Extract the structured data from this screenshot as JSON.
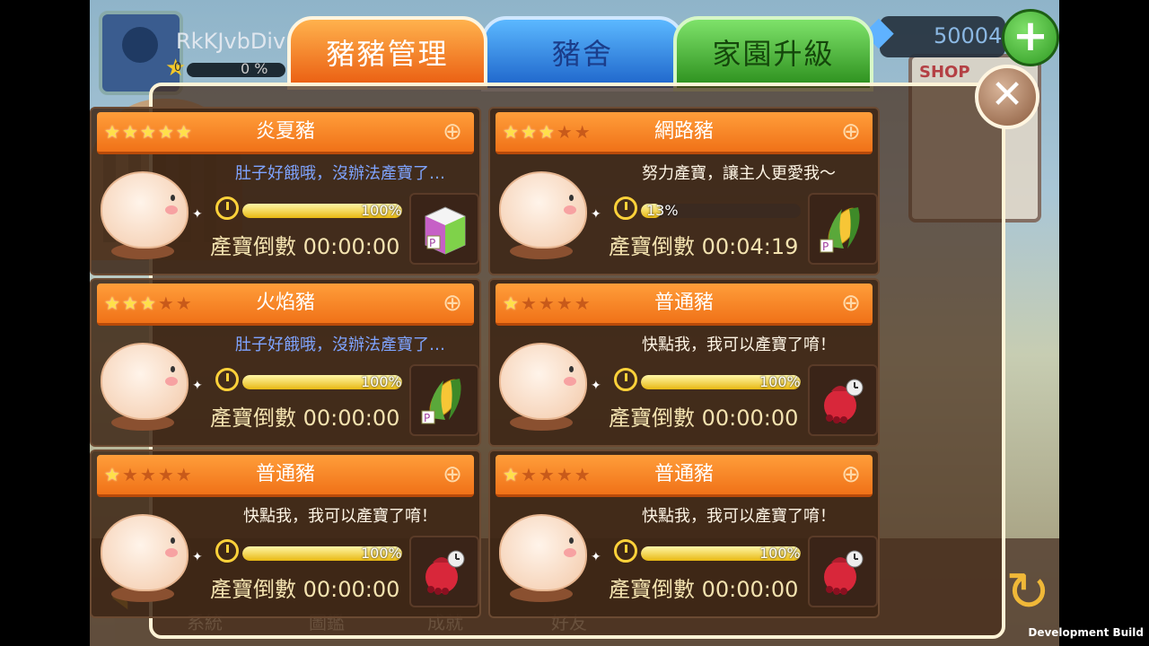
{
  "hud": {
    "username": "RkKJvbDiv",
    "level": "0",
    "xp_percent": "0 %",
    "gems": "50004",
    "add_label": "+"
  },
  "tabs": [
    {
      "label": "豬豬管理",
      "active": true
    },
    {
      "label": "豬舍",
      "active": false
    },
    {
      "label": "家園升級",
      "active": false
    }
  ],
  "close_label": "✕",
  "countdown_label": "產寶倒數",
  "pigs": [
    {
      "name": "炎夏豬",
      "stars": 5,
      "message": "肚子好餓哦，沒辦法產寶了…",
      "message_style": "blue",
      "progress": 100,
      "progress_text": "100%",
      "countdown": "00:00:00",
      "item": "milk-box-icon"
    },
    {
      "name": "網路豬",
      "stars": 3,
      "message": "努力產寶，讓主人更愛我～",
      "message_style": "white",
      "progress": 13,
      "progress_text": "13%",
      "countdown": "00:04:19",
      "item": "corn-icon"
    },
    {
      "name": "火焰豬",
      "stars": 3,
      "message": "肚子好餓哦，沒辦法產寶了…",
      "message_style": "blue",
      "progress": 100,
      "progress_text": "100%",
      "countdown": "00:00:00",
      "item": "corn-icon"
    },
    {
      "name": "普通豬",
      "stars": 1,
      "message": "快點我，我可以產寶了唷！",
      "message_style": "white",
      "progress": 100,
      "progress_text": "100%",
      "countdown": "00:00:00",
      "item": "treasure-bag-icon"
    },
    {
      "name": "普通豬",
      "stars": 1,
      "message": "快點我，我可以產寶了唷！",
      "message_style": "white",
      "progress": 100,
      "progress_text": "100%",
      "countdown": "00:00:00",
      "item": "treasure-bag-icon"
    },
    {
      "name": "普通豬",
      "stars": 1,
      "message": "快點我，我可以產寶了唷！",
      "message_style": "white",
      "progress": 100,
      "progress_text": "100%",
      "countdown": "00:00:00",
      "item": "treasure-bag-icon"
    }
  ],
  "bottom_nav": [
    "系統",
    "圖鑑",
    "成就",
    "好友"
  ],
  "shop_sign": "SHOP",
  "footer": "Development Build"
}
